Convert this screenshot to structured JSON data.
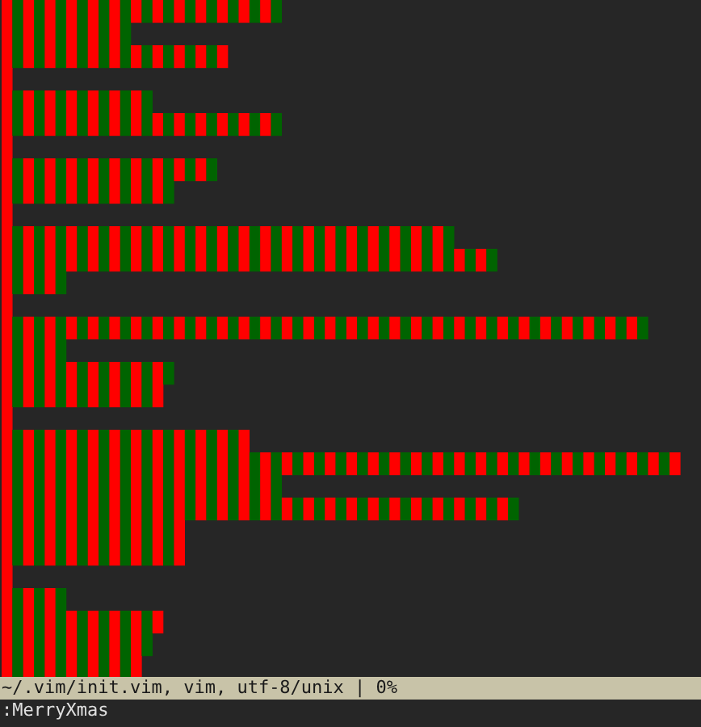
{
  "status_line": {
    "text": "~/.vim/init.vim, vim, utf-8/unix | 0%"
  },
  "command_line": {
    "text": ":MerryXmas"
  }
}
